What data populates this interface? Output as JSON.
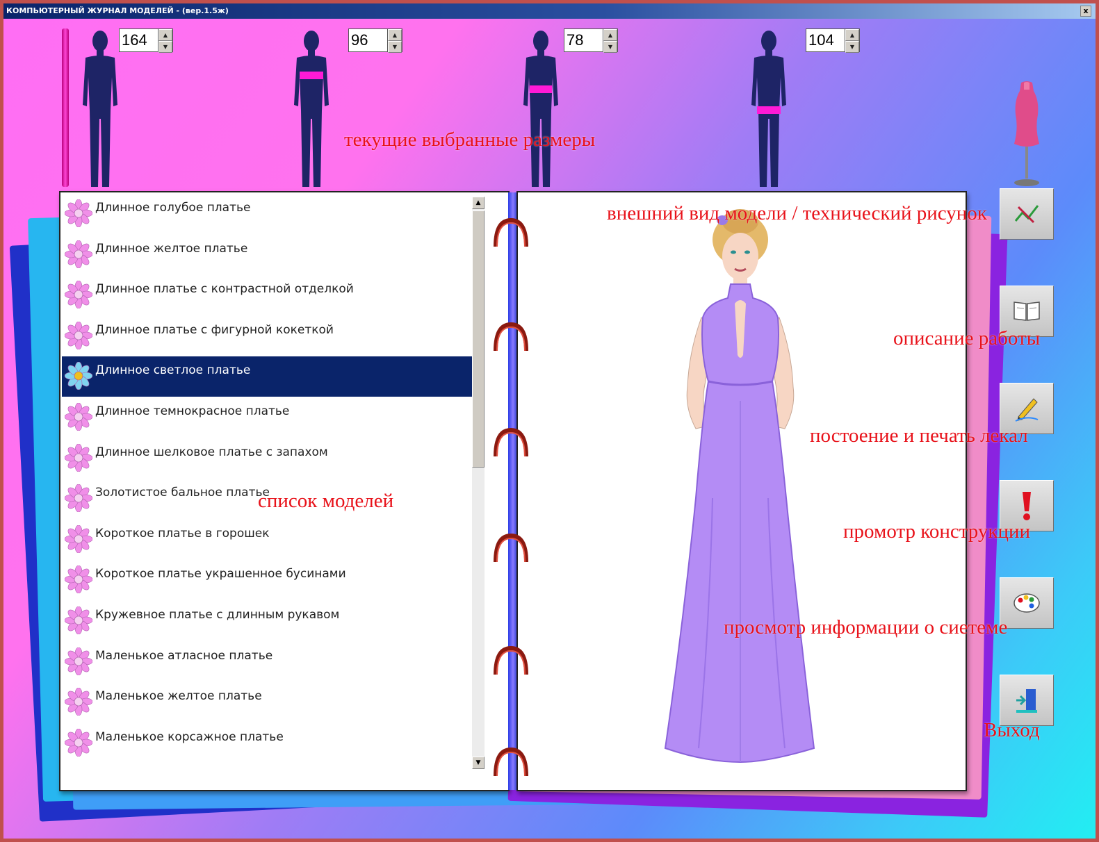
{
  "window": {
    "title": "КОМПЬЮТЕРНЫЙ ЖУРНАЛ МОДЕЛЕЙ - (вер.1.5ж)",
    "close_label": "x"
  },
  "measurements": [
    {
      "name": "height",
      "value": "164"
    },
    {
      "name": "bust",
      "value": "96"
    },
    {
      "name": "waist",
      "value": "78"
    },
    {
      "name": "hips",
      "value": "104"
    }
  ],
  "annotations": {
    "sizes": "текущие выбранные размеры",
    "appearance": "внешний вид модели / технический рисунок",
    "description": "описание работы",
    "patterns": "постоение и печать лекал",
    "construction": "промотр конструкции",
    "system_info": "просмотр информации о сиетеме",
    "exit": "Выход",
    "model_list": "список моделей"
  },
  "models": {
    "items": [
      "Длинное голубое платье",
      "Длинное желтое платье",
      "Длинное платье с контрастной отделкой",
      "Длинное платье с фигурной кокеткой",
      "Длинное светлое платье",
      "Длинное темнокрасное платье",
      "Длинное шелковое платье с запахом",
      "Золотистое бальное платье",
      "Короткое платье в горошек",
      "Короткое платье украшенное бусинами",
      "Кружевное платье с длинным рукавом",
      "Маленькое атласное платье",
      "Маленькое желтое платье",
      "Маленькое корсажное платье"
    ],
    "selected_index": 4
  },
  "side_buttons": [
    {
      "name": "appearance-button",
      "icon": "drawing-icon"
    },
    {
      "name": "description-button",
      "icon": "book-icon"
    },
    {
      "name": "patterns-button",
      "icon": "pencil-icon"
    },
    {
      "name": "construction-button",
      "icon": "exclamation-icon"
    },
    {
      "name": "system-info-button",
      "icon": "palette-icon"
    },
    {
      "name": "exit-button",
      "icon": "exit-door-icon"
    }
  ],
  "colors": {
    "selection": "#0a246a",
    "annotation_text": "#e8121a",
    "dress": "#b48cf5",
    "mannequin": "#1e2466",
    "highlight_band": "#ff1ad6"
  }
}
